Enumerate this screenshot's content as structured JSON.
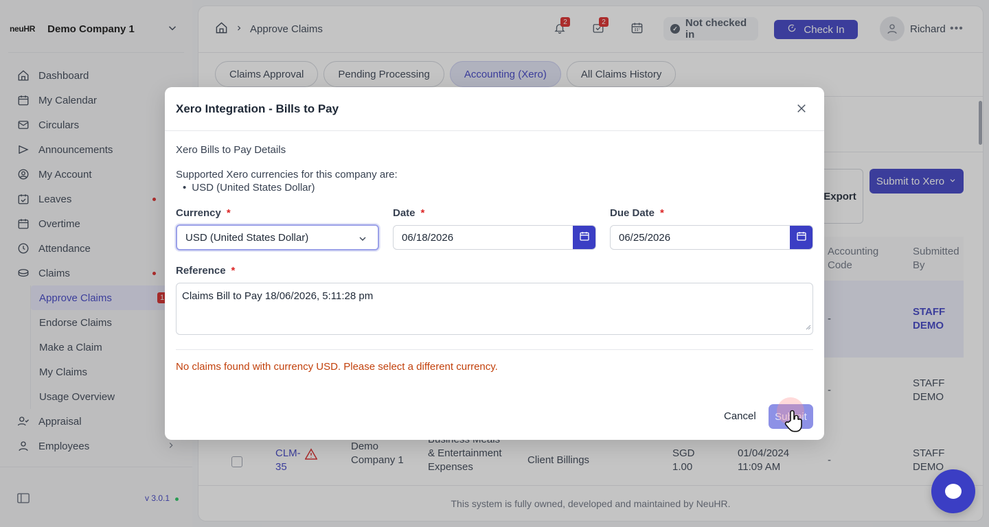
{
  "sidebar": {
    "logo": "neuHR",
    "company": "Demo Company 1",
    "items": [
      {
        "label": "Dashboard",
        "icon": "home-icon"
      },
      {
        "label": "My Calendar",
        "icon": "calendar-icon"
      },
      {
        "label": "Circulars",
        "icon": "mail-icon"
      },
      {
        "label": "Announcements",
        "icon": "megaphone-icon"
      },
      {
        "label": "My Account",
        "icon": "user-circle-icon"
      },
      {
        "label": "Leaves",
        "icon": "calendar-check-icon"
      },
      {
        "label": "Overtime",
        "icon": "calendar-clock-icon"
      },
      {
        "label": "Attendance",
        "icon": "clock-icon"
      },
      {
        "label": "Claims",
        "icon": "coins-icon"
      }
    ],
    "claims_sub": [
      "Approve Claims",
      "Endorse Claims",
      "Make a Claim",
      "My Claims",
      "Usage Overview"
    ],
    "approve_badge": "1",
    "after_items": [
      {
        "label": "Appraisal",
        "icon": "user-check-icon"
      },
      {
        "label": "Employees",
        "icon": "user-icon"
      }
    ],
    "version": "v 3.0.1"
  },
  "topbar": {
    "breadcrumb_page": "Approve Claims",
    "notif_count": "2",
    "task_count": "2",
    "status": "Not checked in",
    "checkin_label": "Check In",
    "user": "Richard"
  },
  "tabs": [
    "Claims Approval",
    "Pending Processing",
    "Accounting (Xero)",
    "All Claims History"
  ],
  "actions": {
    "export": "Export",
    "submit_xero": "Submit to Xero"
  },
  "table": {
    "headers": {
      "accounting_code": "Accounting Code",
      "submitted_by": "Submitted By"
    },
    "rows": [
      {
        "accounting_code": "-",
        "submitted_by": "STAFF DEMO"
      },
      {
        "accounting_code": "-",
        "submitted_by": "STAFF DEMO"
      },
      {
        "claim_id": "CLM-35",
        "company": "Demo Company 1",
        "category": "Business Meals & Entertainment Expenses",
        "project": "Client Billings",
        "amount": "SGD 1.00",
        "date": "01/04/2024 11:09 AM",
        "accounting_code": "-",
        "submitted_by": "STAFF DEMO"
      }
    ]
  },
  "footer": "This system is fully owned, developed and maintained by NeuHR.",
  "modal": {
    "title": "Xero Integration - Bills to Pay",
    "section": "Xero Bills to Pay Details",
    "supported_text": "Supported Xero currencies for this company are:",
    "supported_currency": "USD (United States Dollar)",
    "currency_label": "Currency",
    "currency_value": "USD (United States Dollar)",
    "date_label": "Date",
    "date_value": "06/18/2026",
    "due_date_label": "Due Date",
    "due_date_value": "06/25/2026",
    "reference_label": "Reference",
    "reference_value": "Claims Bill to Pay 18/06/2026, 5:11:28 pm",
    "warning": "No claims found with currency USD. Please select a different currency.",
    "cancel": "Cancel",
    "submit": "Submit"
  },
  "colors": {
    "accent": "#3b3ec4",
    "warning": "#c2410c",
    "badge": "#dc2626"
  }
}
